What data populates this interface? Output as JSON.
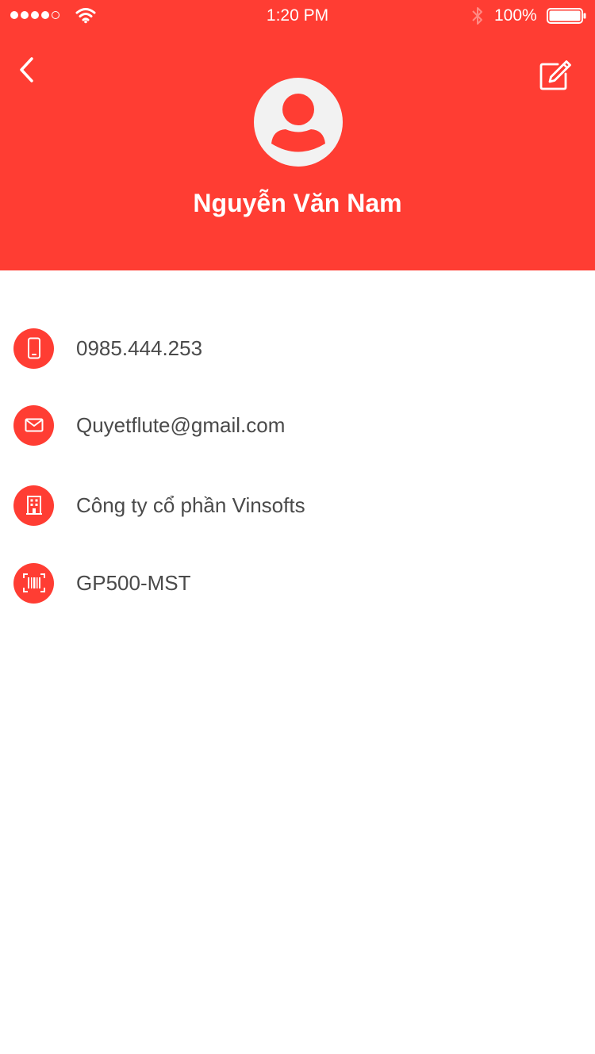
{
  "colors": {
    "accent": "#ff3d33",
    "text": "#4a4a4a",
    "avatar_bg": "#f2f2f2"
  },
  "status_bar": {
    "time": "1:20 PM",
    "battery": "100%",
    "signal_filled": 4,
    "signal_total": 5
  },
  "header": {
    "back_icon": "chevron-left-icon",
    "edit_icon": "edit-icon",
    "avatar_icon": "user-icon",
    "name": "Nguyễn Văn Nam"
  },
  "contact": {
    "phone": {
      "icon": "phone-icon",
      "value": "0985.444.253"
    },
    "email": {
      "icon": "mail-icon",
      "value": "Quyetflute@gmail.com"
    },
    "company": {
      "icon": "building-icon",
      "value": "Công ty cổ phần Vinsofts"
    },
    "license": {
      "icon": "barcode-icon",
      "value": "GP500-MST"
    }
  }
}
